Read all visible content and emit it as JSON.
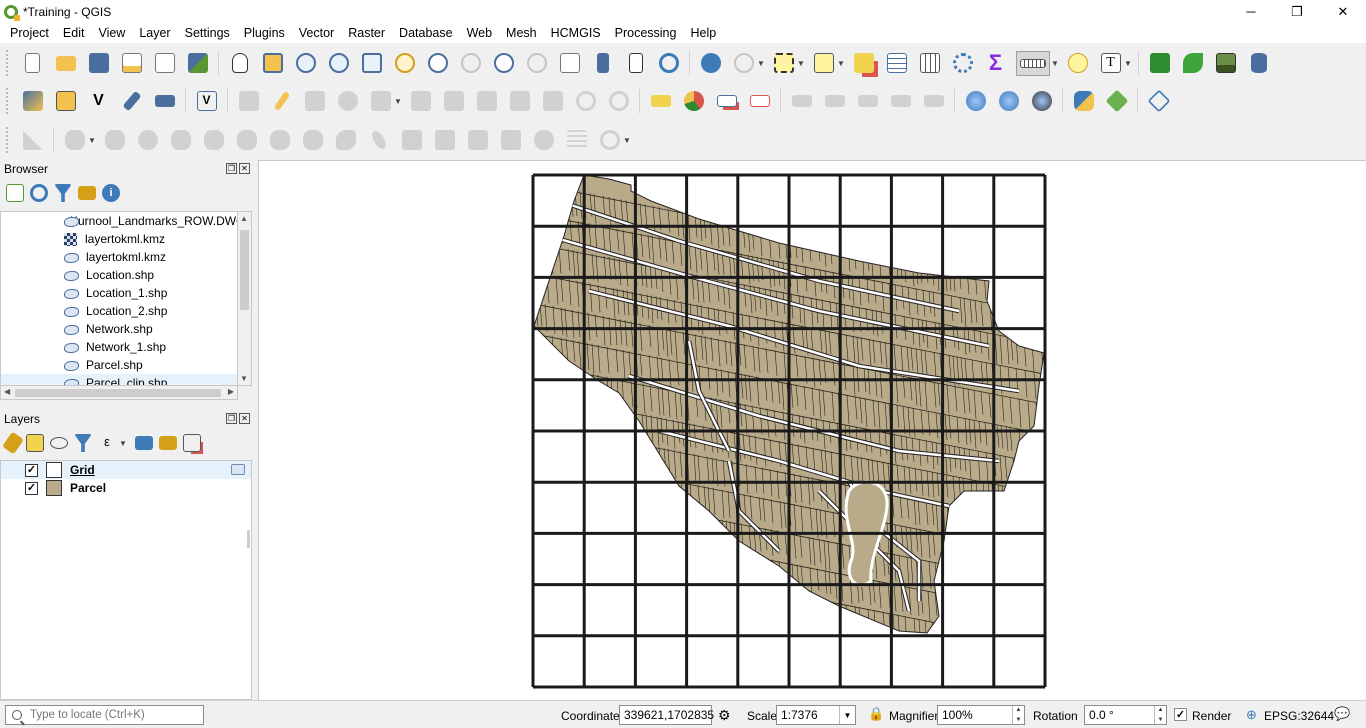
{
  "window": {
    "title": "*Training - QGIS",
    "min_glyph": "─",
    "max_glyph": "❐",
    "close_glyph": "✕"
  },
  "menubar": {
    "items": [
      "Project",
      "Edit",
      "View",
      "Layer",
      "Settings",
      "Plugins",
      "Vector",
      "Raster",
      "Database",
      "Web",
      "Mesh",
      "HCMGIS",
      "Processing",
      "Help"
    ]
  },
  "browser": {
    "title": "Browser",
    "items": [
      {
        "label": "Kurnool_Landmarks_ROW.DWG",
        "type": "shp"
      },
      {
        "label": "layertokml.kmz",
        "type": "kmz"
      },
      {
        "label": "layertokml.kmz",
        "type": "shp"
      },
      {
        "label": "Location.shp",
        "type": "shp"
      },
      {
        "label": "Location_1.shp",
        "type": "shp"
      },
      {
        "label": "Location_2.shp",
        "type": "shp"
      },
      {
        "label": "Network.shp",
        "type": "shp"
      },
      {
        "label": "Network_1.shp",
        "type": "shp"
      },
      {
        "label": "Parcel.shp",
        "type": "shp"
      },
      {
        "label": "Parcel_clip.shp",
        "type": "shp"
      }
    ]
  },
  "layers": {
    "title": "Layers",
    "items": [
      {
        "label": "Grid",
        "checked": "✓",
        "symbol": "grid"
      },
      {
        "label": "Parcel",
        "checked": "✓",
        "symbol": "parcel"
      }
    ]
  },
  "statusbar": {
    "locator_placeholder": "Type to locate (Ctrl+K)",
    "coordinate_label": "Coordinate",
    "coordinate_value": "339621,1702835",
    "scale_label": "Scale",
    "scale_value": "1:7376",
    "magnifier_label": "Magnifier",
    "magnifier_value": "100%",
    "rotation_label": "Rotation",
    "rotation_value": "0.0 °",
    "render_label": "Render",
    "render_checked": "✓",
    "crs_label": "EPSG:32644"
  },
  "map": {
    "grid_rows": 10,
    "grid_cols": 10,
    "parcel_color": "#b9aa8a",
    "grid_color": "#1a1a1a"
  }
}
